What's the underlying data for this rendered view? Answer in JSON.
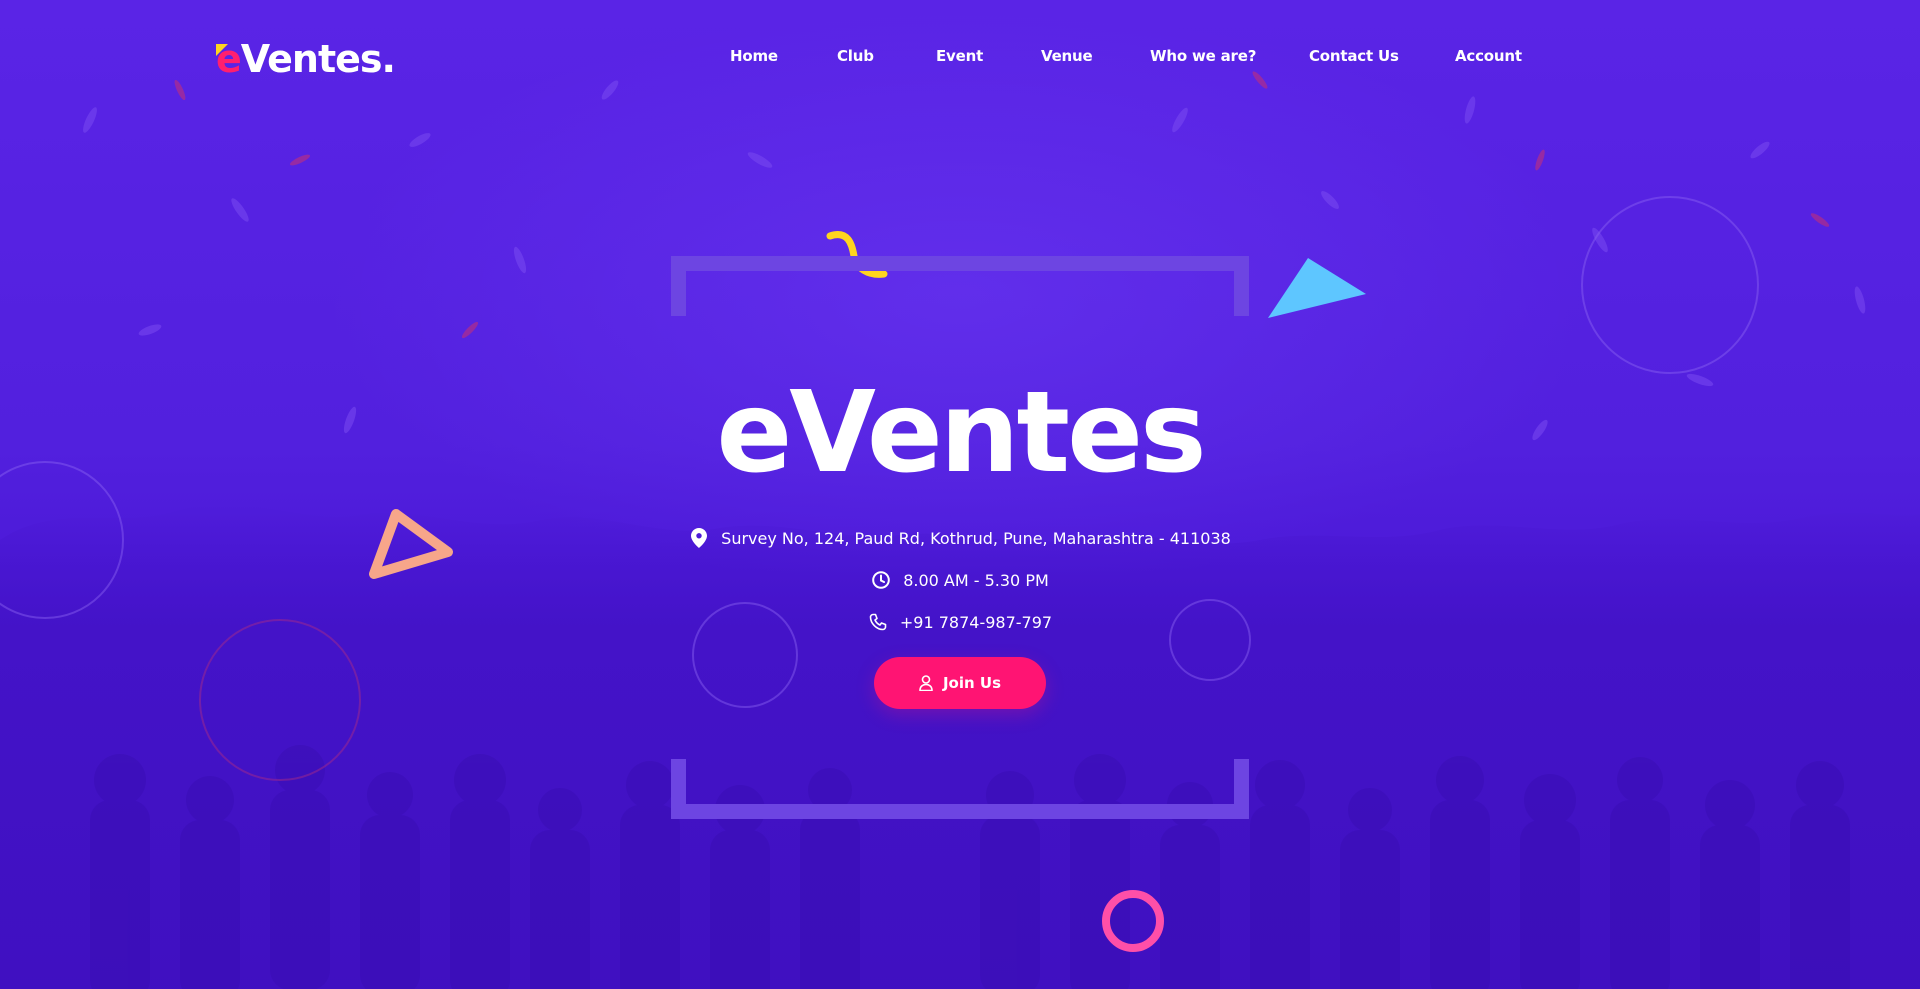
{
  "brand": {
    "logo_e": "e",
    "logo_rest": "Ventes."
  },
  "nav": {
    "items": [
      {
        "label": "Home"
      },
      {
        "label": "Club"
      },
      {
        "label": "Event"
      },
      {
        "label": "Venue"
      },
      {
        "label": "Who we are?"
      },
      {
        "label": "Contact Us"
      },
      {
        "label": "Account"
      }
    ]
  },
  "hero": {
    "title": "eVentes",
    "address": "Survey No, 124, Paud Rd, Kothrud, Pune, Maharashtra - 411038",
    "hours": "8.00 AM - 5.30 PM",
    "phone": "+91 7874-987-797",
    "cta_label": "Join Us"
  },
  "icons": {
    "address": "map-pin-icon",
    "hours": "clock-icon",
    "phone": "phone-icon",
    "cta": "user-icon"
  },
  "colors": {
    "background": "#5220de",
    "accent_pink": "#ff1473",
    "logo_yellow": "#ffd51f",
    "frame": "#6d45e2",
    "triangle_blue": "#5ec6ff",
    "triangle_peach": "#f7a68a",
    "squiggle_yellow": "#ffd51f",
    "ring_pink": "#ff4fa8"
  }
}
